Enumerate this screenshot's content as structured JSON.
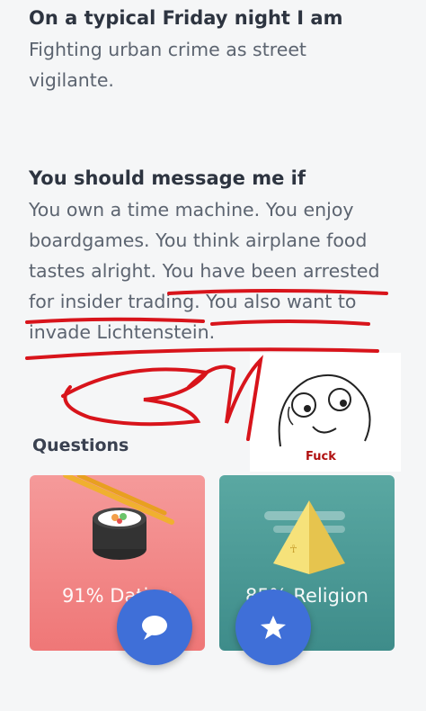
{
  "profile": {
    "friday": {
      "heading": "On a typical Friday night I am",
      "text": "Fighting urban crime as street vigilante."
    },
    "message": {
      "heading": "You should message me if",
      "text": "You own a time machine. You enjoy boardgames. You think airplane food tastes alright. You have been arrested for insider trading. You also want to invade Lichtenstein."
    }
  },
  "questions": {
    "title": "Questions",
    "cards": [
      {
        "label": "91% Dating",
        "icon": "sushi-roll-icon",
        "color": "#ef7777"
      },
      {
        "label": "85% Religion",
        "icon": "pyramid-icon",
        "color": "#3e8c8a"
      }
    ]
  },
  "actions": {
    "chat_icon": "chat-bubble-icon",
    "star_icon": "star-icon",
    "accent": "#3f6fd8"
  },
  "annotation": {
    "caption": "Fuck",
    "ink_color": "#d8141b"
  }
}
